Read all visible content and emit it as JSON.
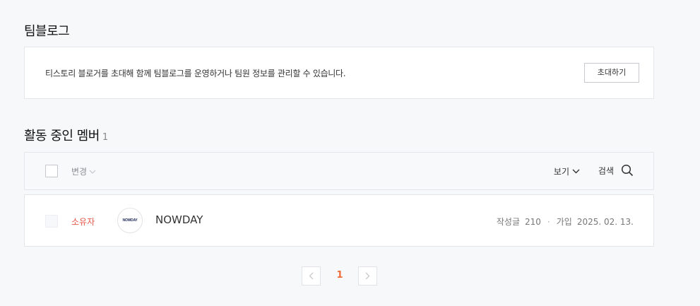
{
  "team_blog": {
    "title": "팀블로그",
    "description": "티스토리 블로거를 초대해 함께 팀블로그를 운영하거나 팀원 정보를 관리할 수 있습니다.",
    "invite_label": "초대하기"
  },
  "members": {
    "title": "활동 중인 멤버",
    "count": "1",
    "toolbar": {
      "change_label": "변경",
      "view_label": "보기",
      "search_label": "검색"
    },
    "rows": [
      {
        "role": "소유자",
        "avatar_text": "NOWDAY",
        "name": "NOWDAY",
        "posts_label": "작성글",
        "posts_count": "210",
        "joined_label": "가입",
        "joined_date": "2025. 02. 13."
      }
    ]
  },
  "pagination": {
    "current_page": "1"
  },
  "colors": {
    "accent": "#f06b3a",
    "role_owner": "#e5584a"
  }
}
